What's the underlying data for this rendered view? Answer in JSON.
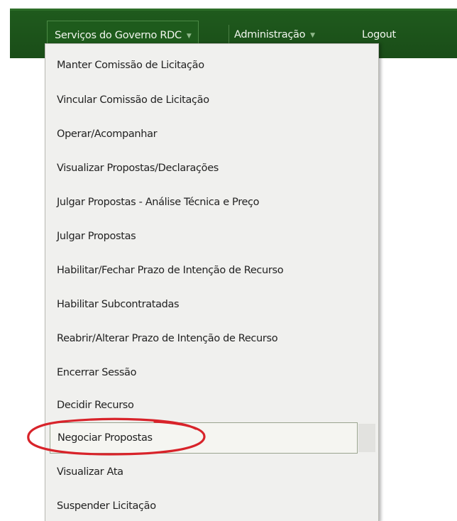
{
  "navbar": {
    "items": [
      {
        "label": "Serviços do Governo RDC",
        "has_dropdown": true
      },
      {
        "label": "Administração",
        "has_dropdown": true
      },
      {
        "label": "Logout",
        "has_dropdown": false
      }
    ],
    "caret_glyph": "▼"
  },
  "dropdown": {
    "items": [
      {
        "label": "Manter Comissão de Licitação"
      },
      {
        "label": "Vincular Comissão de Licitação"
      },
      {
        "label": "Operar/Acompanhar"
      },
      {
        "label": "Visualizar Propostas/Declarações"
      },
      {
        "label": "Julgar Propostas - Análise Técnica e Preço"
      },
      {
        "label": "Julgar Propostas"
      },
      {
        "label": "Habilitar/Fechar Prazo de Intenção de Recurso"
      },
      {
        "label": "Habilitar Subcontratadas"
      },
      {
        "label": "Reabrir/Alterar Prazo de Intenção de Recurso"
      },
      {
        "label": "Encerrar Sessão"
      },
      {
        "label": "Decidir Recurso"
      },
      {
        "label": "Negociar Propostas",
        "selected": true
      },
      {
        "label": "Visualizar Ata"
      },
      {
        "label": "Suspender Licitação"
      }
    ],
    "selected_index": 11
  },
  "colors": {
    "navbar_bg": "#1f5a1d",
    "menu_bg": "#f0f0ee",
    "annotation_ring": "#d8232a"
  }
}
